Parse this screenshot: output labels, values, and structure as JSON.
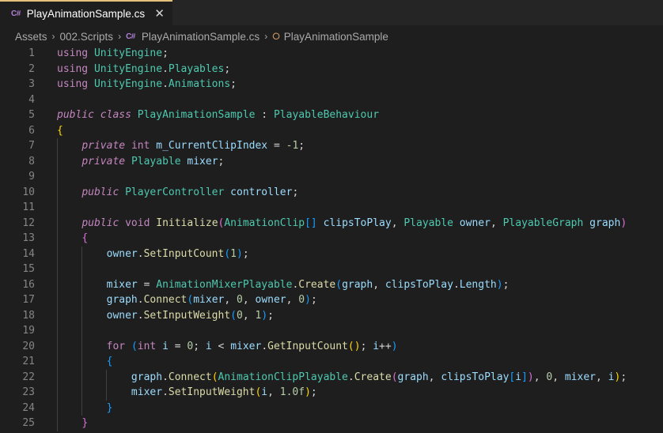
{
  "tab": {
    "icon": "C#",
    "title": "PlayAnimationSample.cs",
    "close": "✕"
  },
  "breadcrumb": {
    "items": [
      "Assets",
      "002.Scripts",
      "PlayAnimationSample.cs",
      "PlayAnimationSample"
    ],
    "file_icon": "C#"
  },
  "colors": {
    "background": "#1e1e1e",
    "tab_accent": "#e5c07b",
    "keyword": "#c586c0",
    "type": "#4ec9b0",
    "function": "#dcdcaa",
    "number": "#b5cea8",
    "variable": "#9cdcfe"
  },
  "lines": [
    {
      "n": "1",
      "tokens": [
        [
          "kw",
          "using"
        ],
        [
          "pu",
          " "
        ],
        [
          "ns",
          "UnityEngine"
        ],
        [
          "pu",
          ";"
        ]
      ]
    },
    {
      "n": "2",
      "tokens": [
        [
          "kw",
          "using"
        ],
        [
          "pu",
          " "
        ],
        [
          "ns",
          "UnityEngine"
        ],
        [
          "pu",
          "."
        ],
        [
          "ns",
          "Playables"
        ],
        [
          "pu",
          ";"
        ]
      ]
    },
    {
      "n": "3",
      "tokens": [
        [
          "kw",
          "using"
        ],
        [
          "pu",
          " "
        ],
        [
          "ns",
          "UnityEngine"
        ],
        [
          "pu",
          "."
        ],
        [
          "ns",
          "Animations"
        ],
        [
          "pu",
          ";"
        ]
      ]
    },
    {
      "n": "4",
      "tokens": []
    },
    {
      "n": "5",
      "tokens": [
        [
          "kwi",
          "public"
        ],
        [
          "pu",
          " "
        ],
        [
          "kwi",
          "class"
        ],
        [
          "pu",
          " "
        ],
        [
          "ty",
          "PlayAnimationSample"
        ],
        [
          "pu",
          " : "
        ],
        [
          "ty",
          "PlayableBehaviour"
        ]
      ]
    },
    {
      "n": "6",
      "tokens": [
        [
          "br1",
          "{"
        ]
      ]
    },
    {
      "n": "7",
      "indent": 1,
      "tokens": [
        [
          "kwi",
          "private"
        ],
        [
          "pu",
          " "
        ],
        [
          "kw",
          "int"
        ],
        [
          "pu",
          " "
        ],
        [
          "vr",
          "m_CurrentClipIndex"
        ],
        [
          "pu",
          " = "
        ],
        [
          "nm",
          "-1"
        ],
        [
          "pu",
          ";"
        ]
      ]
    },
    {
      "n": "8",
      "indent": 1,
      "tokens": [
        [
          "kwi",
          "private"
        ],
        [
          "pu",
          " "
        ],
        [
          "ty",
          "Playable"
        ],
        [
          "pu",
          " "
        ],
        [
          "vr",
          "mixer"
        ],
        [
          "pu",
          ";"
        ]
      ]
    },
    {
      "n": "9",
      "indent": 1,
      "tokens": []
    },
    {
      "n": "10",
      "indent": 1,
      "tokens": [
        [
          "kwi",
          "public"
        ],
        [
          "pu",
          " "
        ],
        [
          "ty",
          "PlayerController"
        ],
        [
          "pu",
          " "
        ],
        [
          "vr",
          "controller"
        ],
        [
          "pu",
          ";"
        ]
      ]
    },
    {
      "n": "11",
      "indent": 1,
      "tokens": []
    },
    {
      "n": "12",
      "indent": 1,
      "tokens": [
        [
          "kwi",
          "public"
        ],
        [
          "pu",
          " "
        ],
        [
          "kw",
          "void"
        ],
        [
          "pu",
          " "
        ],
        [
          "fn",
          "Initialize"
        ],
        [
          "br2",
          "("
        ],
        [
          "ty",
          "AnimationClip"
        ],
        [
          "br3",
          "[]"
        ],
        [
          "pu",
          " "
        ],
        [
          "vr",
          "clipsToPlay"
        ],
        [
          "pu",
          ", "
        ],
        [
          "ty",
          "Playable"
        ],
        [
          "pu",
          " "
        ],
        [
          "vr",
          "owner"
        ],
        [
          "pu",
          ", "
        ],
        [
          "ty",
          "PlayableGraph"
        ],
        [
          "pu",
          " "
        ],
        [
          "vr",
          "graph"
        ],
        [
          "br2",
          ")"
        ]
      ]
    },
    {
      "n": "13",
      "indent": 1,
      "tokens": [
        [
          "br2",
          "{"
        ]
      ]
    },
    {
      "n": "14",
      "indent": 2,
      "tokens": [
        [
          "vr",
          "owner"
        ],
        [
          "pu",
          "."
        ],
        [
          "fn",
          "SetInputCount"
        ],
        [
          "br3",
          "("
        ],
        [
          "nm",
          "1"
        ],
        [
          "br3",
          ")"
        ],
        [
          "pu",
          ";"
        ]
      ]
    },
    {
      "n": "15",
      "indent": 2,
      "tokens": []
    },
    {
      "n": "16",
      "indent": 2,
      "tokens": [
        [
          "vr",
          "mixer"
        ],
        [
          "pu",
          " = "
        ],
        [
          "ty",
          "AnimationMixerPlayable"
        ],
        [
          "pu",
          "."
        ],
        [
          "fn",
          "Create"
        ],
        [
          "br3",
          "("
        ],
        [
          "vr",
          "graph"
        ],
        [
          "pu",
          ", "
        ],
        [
          "vr",
          "clipsToPlay"
        ],
        [
          "pu",
          "."
        ],
        [
          "vr",
          "Length"
        ],
        [
          "br3",
          ")"
        ],
        [
          "pu",
          ";"
        ]
      ]
    },
    {
      "n": "17",
      "indent": 2,
      "tokens": [
        [
          "vr",
          "graph"
        ],
        [
          "pu",
          "."
        ],
        [
          "fn",
          "Connect"
        ],
        [
          "br3",
          "("
        ],
        [
          "vr",
          "mixer"
        ],
        [
          "pu",
          ", "
        ],
        [
          "nm",
          "0"
        ],
        [
          "pu",
          ", "
        ],
        [
          "vr",
          "owner"
        ],
        [
          "pu",
          ", "
        ],
        [
          "nm",
          "0"
        ],
        [
          "br3",
          ")"
        ],
        [
          "pu",
          ";"
        ]
      ]
    },
    {
      "n": "18",
      "indent": 2,
      "tokens": [
        [
          "vr",
          "owner"
        ],
        [
          "pu",
          "."
        ],
        [
          "fn",
          "SetInputWeight"
        ],
        [
          "br3",
          "("
        ],
        [
          "nm",
          "0"
        ],
        [
          "pu",
          ", "
        ],
        [
          "nm",
          "1"
        ],
        [
          "br3",
          ")"
        ],
        [
          "pu",
          ";"
        ]
      ]
    },
    {
      "n": "19",
      "indent": 2,
      "tokens": []
    },
    {
      "n": "20",
      "indent": 2,
      "tokens": [
        [
          "kw",
          "for"
        ],
        [
          "pu",
          " "
        ],
        [
          "br3",
          "("
        ],
        [
          "kw",
          "int"
        ],
        [
          "pu",
          " "
        ],
        [
          "vr",
          "i"
        ],
        [
          "pu",
          " = "
        ],
        [
          "nm",
          "0"
        ],
        [
          "pu",
          "; "
        ],
        [
          "vr",
          "i"
        ],
        [
          "pu",
          " < "
        ],
        [
          "vr",
          "mixer"
        ],
        [
          "pu",
          "."
        ],
        [
          "fn",
          "GetInputCount"
        ],
        [
          "br1",
          "()"
        ],
        [
          "pu",
          "; "
        ],
        [
          "vr",
          "i"
        ],
        [
          "pu",
          "++"
        ],
        [
          "br3",
          ")"
        ]
      ]
    },
    {
      "n": "21",
      "indent": 2,
      "tokens": [
        [
          "br3",
          "{"
        ]
      ]
    },
    {
      "n": "22",
      "indent": 3,
      "tokens": [
        [
          "vr",
          "graph"
        ],
        [
          "pu",
          "."
        ],
        [
          "fn",
          "Connect"
        ],
        [
          "br1",
          "("
        ],
        [
          "ty",
          "AnimationClipPlayable"
        ],
        [
          "pu",
          "."
        ],
        [
          "fn",
          "Create"
        ],
        [
          "br2",
          "("
        ],
        [
          "vr",
          "graph"
        ],
        [
          "pu",
          ", "
        ],
        [
          "vr",
          "clipsToPlay"
        ],
        [
          "br3",
          "["
        ],
        [
          "vr",
          "i"
        ],
        [
          "br3",
          "]"
        ],
        [
          "br2",
          ")"
        ],
        [
          "pu",
          ", "
        ],
        [
          "nm",
          "0"
        ],
        [
          "pu",
          ", "
        ],
        [
          "vr",
          "mixer"
        ],
        [
          "pu",
          ", "
        ],
        [
          "vr",
          "i"
        ],
        [
          "br1",
          ")"
        ],
        [
          "pu",
          ";"
        ]
      ]
    },
    {
      "n": "23",
      "indent": 3,
      "tokens": [
        [
          "vr",
          "mixer"
        ],
        [
          "pu",
          "."
        ],
        [
          "fn",
          "SetInputWeight"
        ],
        [
          "br1",
          "("
        ],
        [
          "vr",
          "i"
        ],
        [
          "pu",
          ", "
        ],
        [
          "nm",
          "1.0f"
        ],
        [
          "br1",
          ")"
        ],
        [
          "pu",
          ";"
        ]
      ]
    },
    {
      "n": "24",
      "indent": 2,
      "tokens": [
        [
          "br3",
          "}"
        ]
      ]
    },
    {
      "n": "25",
      "indent": 1,
      "tokens": [
        [
          "br2",
          "}"
        ]
      ]
    }
  ]
}
